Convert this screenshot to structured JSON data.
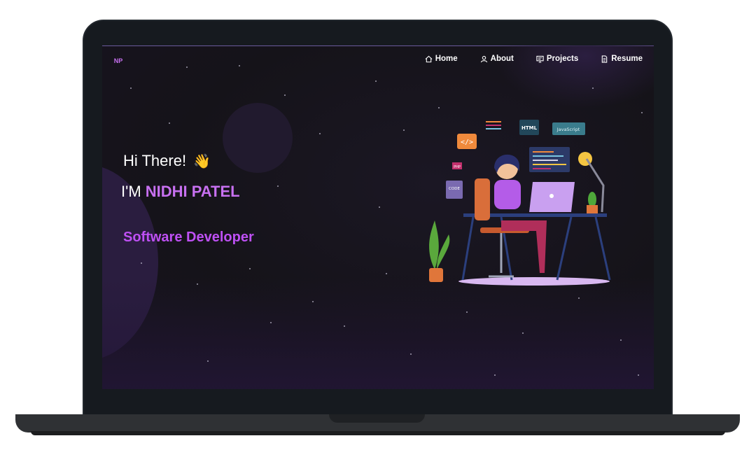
{
  "brand": {
    "logo_text": "NP"
  },
  "nav": {
    "items": [
      {
        "label": "Home",
        "icon": "home-icon"
      },
      {
        "label": "About",
        "icon": "user-icon"
      },
      {
        "label": "Projects",
        "icon": "projects-icon"
      },
      {
        "label": "Resume",
        "icon": "document-icon"
      }
    ]
  },
  "hero": {
    "greeting": "Hi There!",
    "wave_icon": "waving-hand-icon",
    "intro_prefix": "I'M ",
    "name": "NIDHI PATEL",
    "role": "Software Developer"
  },
  "illustration": {
    "tags": [
      "HTML",
      "JavaScript",
      "</>",
      "PHP",
      "CODE"
    ]
  },
  "colors": {
    "accent": "#c770f0",
    "role": "#be50f4",
    "background": "#151319",
    "frame": "#161a1f"
  }
}
